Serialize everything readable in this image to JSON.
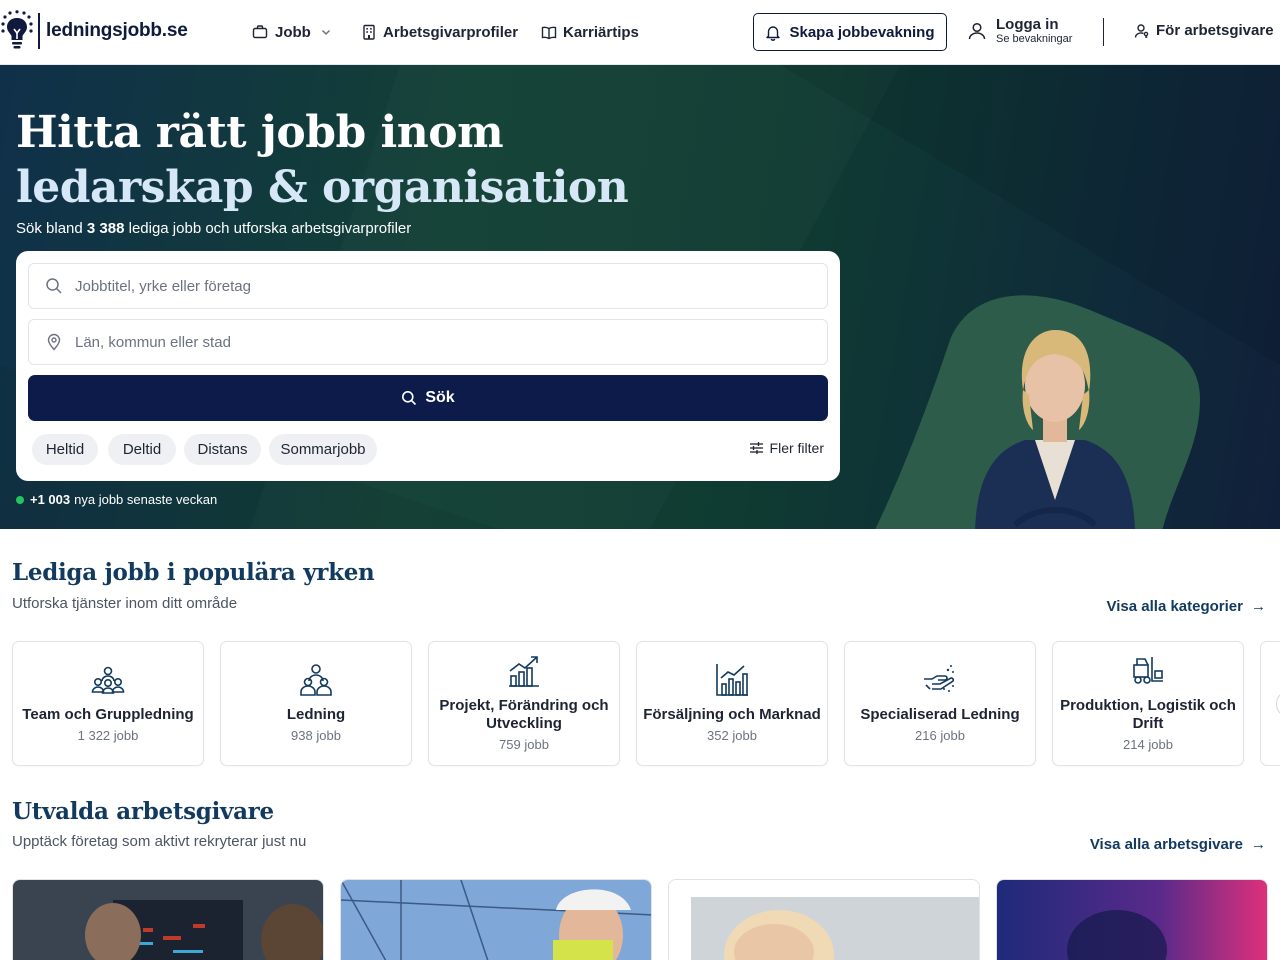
{
  "header": {
    "brand": "ledningsjobb.se",
    "nav": {
      "jobs": "Jobb",
      "employer_profiles": "Arbetsgivarprofiler",
      "career_tips": "Karriärtips"
    },
    "create_alert": "Skapa jobbevakning",
    "login": "Logga in",
    "login_sub": "Se bevakningar",
    "for_employers": "För arbetsgivare"
  },
  "hero": {
    "title_line1": "Hitta rätt jobb inom",
    "title_line2": "ledarskap & organisation",
    "sub_prefix": "Sök bland ",
    "job_count": "3 388",
    "sub_suffix": " lediga jobb och utforska arbetsgivarprofiler",
    "search": {
      "what_placeholder": "Jobbtitel, yrke eller företag",
      "what_value": "",
      "where_placeholder": "Län, kommun eller stad",
      "where_value": "",
      "button": "Sök"
    },
    "chips": [
      "Heltid",
      "Deltid",
      "Distans",
      "Sommarjobb"
    ],
    "more_filters": "Fler filter",
    "new_jobs_count": "+1 003",
    "new_jobs_text": "nya jobb senaste veckan"
  },
  "popular": {
    "title": "Lediga jobb i populära yrken",
    "subtitle": "Utforska tjänster inom ditt område",
    "see_all": "Visa alla kategorier",
    "categories": [
      {
        "name": "Team och Gruppledning",
        "count": "1 322 jobb",
        "icon": "team-icon"
      },
      {
        "name": "Ledning",
        "count": "938 jobb",
        "icon": "group-icon"
      },
      {
        "name": "Projekt, Förändring och Utveckling",
        "count": "759 jobb",
        "icon": "growth-chart-icon"
      },
      {
        "name": "Försäljning och Marknad",
        "count": "352 jobb",
        "icon": "bar-chart-icon"
      },
      {
        "name": "Specialiserad Ledning",
        "count": "216 jobb",
        "icon": "hand-sparkle-icon"
      },
      {
        "name": "Produktion, Logistik och Drift",
        "count": "214 jobb",
        "icon": "forklift-icon"
      }
    ]
  },
  "employers": {
    "title": "Utvalda arbetsgivare",
    "subtitle": "Upptäck företag som aktivt rekryterar just nu",
    "see_all": "Visa alla arbetsgivare"
  },
  "colors": {
    "brand_navy": "#0d1b4b",
    "heading_blue": "#123a5e",
    "hero_green": "#124035",
    "new_dot": "#22c55e"
  }
}
